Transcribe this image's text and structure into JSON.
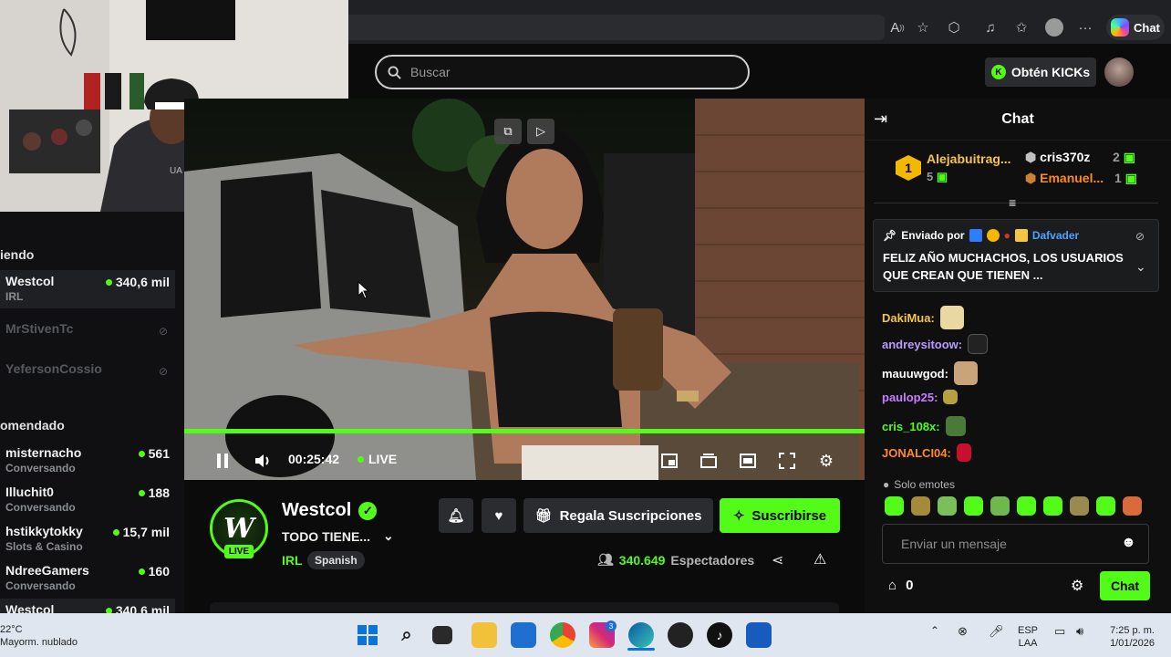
{
  "browser": {
    "copilot_label": "Chat"
  },
  "header": {
    "search_placeholder": "Buscar",
    "obtain_kicks": "Obtén KICKs"
  },
  "sidebar": {
    "following_heading": "iendo",
    "following": [
      {
        "name": "Westcol",
        "sub": "IRL",
        "viewers": "340,6 mil",
        "live": true
      },
      {
        "name": "MrStivenTc",
        "sub": "",
        "viewers": "",
        "live": false
      },
      {
        "name": "YefersonCossio",
        "sub": "",
        "viewers": "",
        "live": false
      }
    ],
    "recommended_heading": "omendado",
    "recommended": [
      {
        "name": "misternacho",
        "sub": "Conversando",
        "viewers": "561"
      },
      {
        "name": "Illuchit0",
        "sub": "Conversando",
        "viewers": "188"
      },
      {
        "name": "hstikkytokky",
        "sub": "Slots & Casino",
        "viewers": "15,7 mil"
      },
      {
        "name": "NdreeGamers",
        "sub": "Conversando",
        "viewers": "160"
      },
      {
        "name": "Westcol",
        "sub": "",
        "viewers": "340,6 mil"
      }
    ]
  },
  "player": {
    "time": "00:25:42",
    "live_label": "LIVE",
    "progress": 1.0
  },
  "channel": {
    "name": "Westcol",
    "avatar_letter": "W",
    "live_badge": "LIVE",
    "title": "TODO TIENE...",
    "category": "IRL",
    "language": "Spanish",
    "gift_label": "Regala Suscripciones",
    "subscribe_label": "Suscribirse",
    "viewers_count": "340.649",
    "viewers_label": "Espectadores"
  },
  "chat": {
    "title": "Chat",
    "leaderboard": {
      "first": {
        "rank": "1",
        "name": "Alejabuitrag...",
        "count": "5"
      },
      "second": {
        "name": "cris370z",
        "count": "2"
      },
      "third": {
        "name": "Emanuel...",
        "count": "1"
      }
    },
    "pinned": {
      "sent_by_label": "Enviado por",
      "sender": "Dafvader",
      "message": "FELIZ AÑO MUCHACHOS, LOS USUARIOS QUE CREAN QUE TIENEN ..."
    },
    "messages": [
      {
        "user": "DakiMua:",
        "color": "#f5c542"
      },
      {
        "user": "andreysitoow:",
        "color": "#b79cff"
      },
      {
        "user": "mauuwgod:",
        "color": "#ffffff"
      },
      {
        "user": "paulop25:",
        "color": "#c77dff"
      },
      {
        "user": "cris_108x:",
        "color": "#53fc18"
      },
      {
        "user": "JONALCI04:",
        "color": "#ff8a1e"
      }
    ],
    "emotes_only": "Solo emotes",
    "input_placeholder": "Enviar un mensaje",
    "kick_count": "0",
    "send_label": "Chat"
  },
  "taskbar": {
    "weather_temp": "22°C",
    "weather_desc": "Mayorm. nublado",
    "lang": "ESP",
    "layout": "LAA",
    "time": "7:25 p. m.",
    "date": "1/01/2026",
    "instagram_badge": "3"
  }
}
